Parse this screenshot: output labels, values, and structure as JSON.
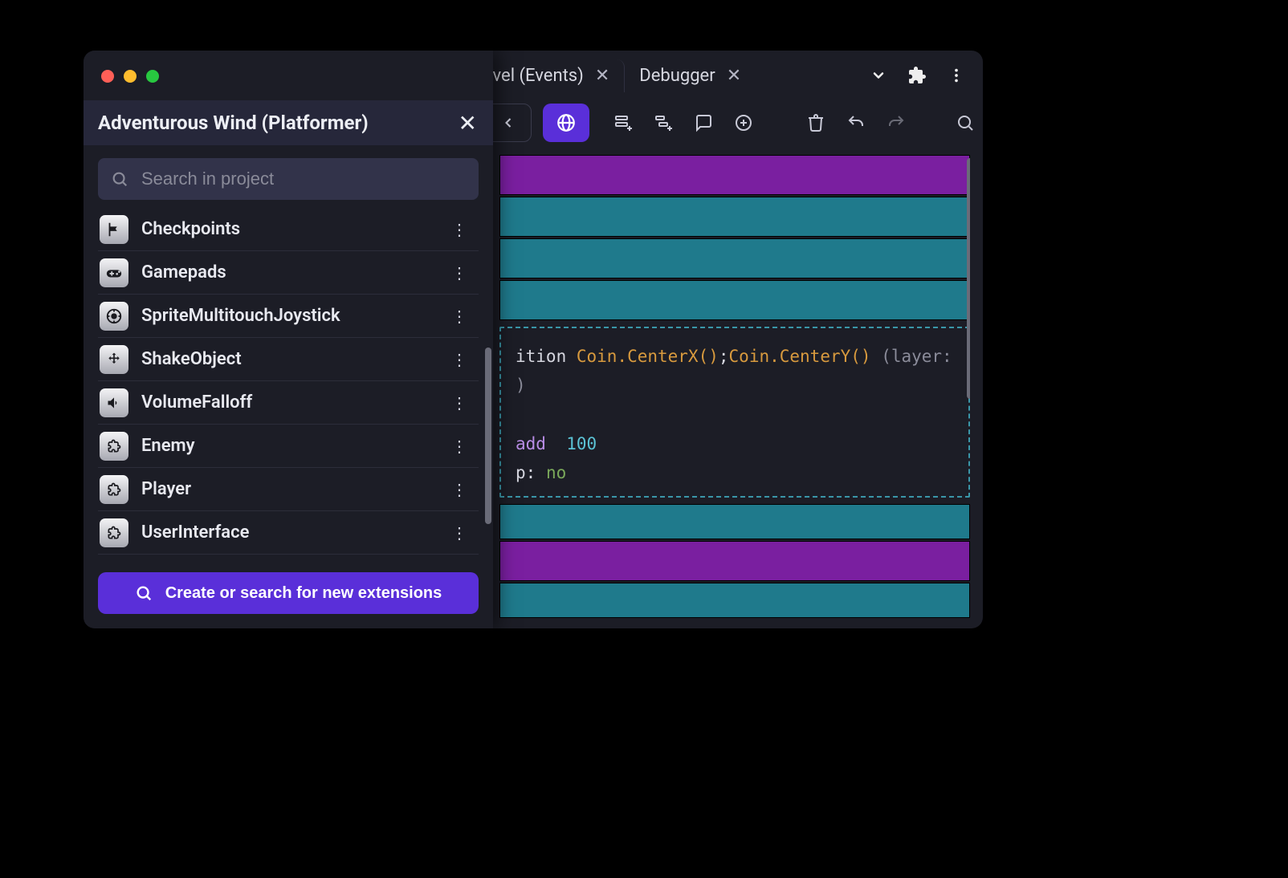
{
  "window": {
    "traffic": [
      "close",
      "minimize",
      "zoom"
    ]
  },
  "tabs": [
    {
      "label": "evel (Events)",
      "closeable": true
    },
    {
      "label": "Debugger",
      "closeable": true
    }
  ],
  "toolbar": {
    "globe_active": true
  },
  "sidebar": {
    "title": "Adventurous Wind (Platformer)",
    "search_placeholder": "Search in project",
    "items": [
      {
        "icon": "flag",
        "label": "Checkpoints"
      },
      {
        "icon": "gamepad",
        "label": "Gamepads"
      },
      {
        "icon": "joystick",
        "label": "SpriteMultitouchJoystick"
      },
      {
        "icon": "move",
        "label": "ShakeObject"
      },
      {
        "icon": "volume",
        "label": "VolumeFalloff"
      },
      {
        "icon": "puzzle",
        "label": "Enemy"
      },
      {
        "icon": "puzzle",
        "label": "Player"
      },
      {
        "icon": "puzzle",
        "label": "UserInterface"
      }
    ],
    "create_label": "Create or search for new extensions"
  },
  "events": {
    "code_line1": {
      "prefix": "ition ",
      "arg1": "Coin.CenterX()",
      "sep1": ";",
      "arg2": "Coin.CenterY()",
      "suffix": " (layer: )"
    },
    "code_line2": {
      "op": "add",
      "val": "100"
    },
    "code_line3": {
      "key": "p:",
      "val": "no"
    }
  }
}
